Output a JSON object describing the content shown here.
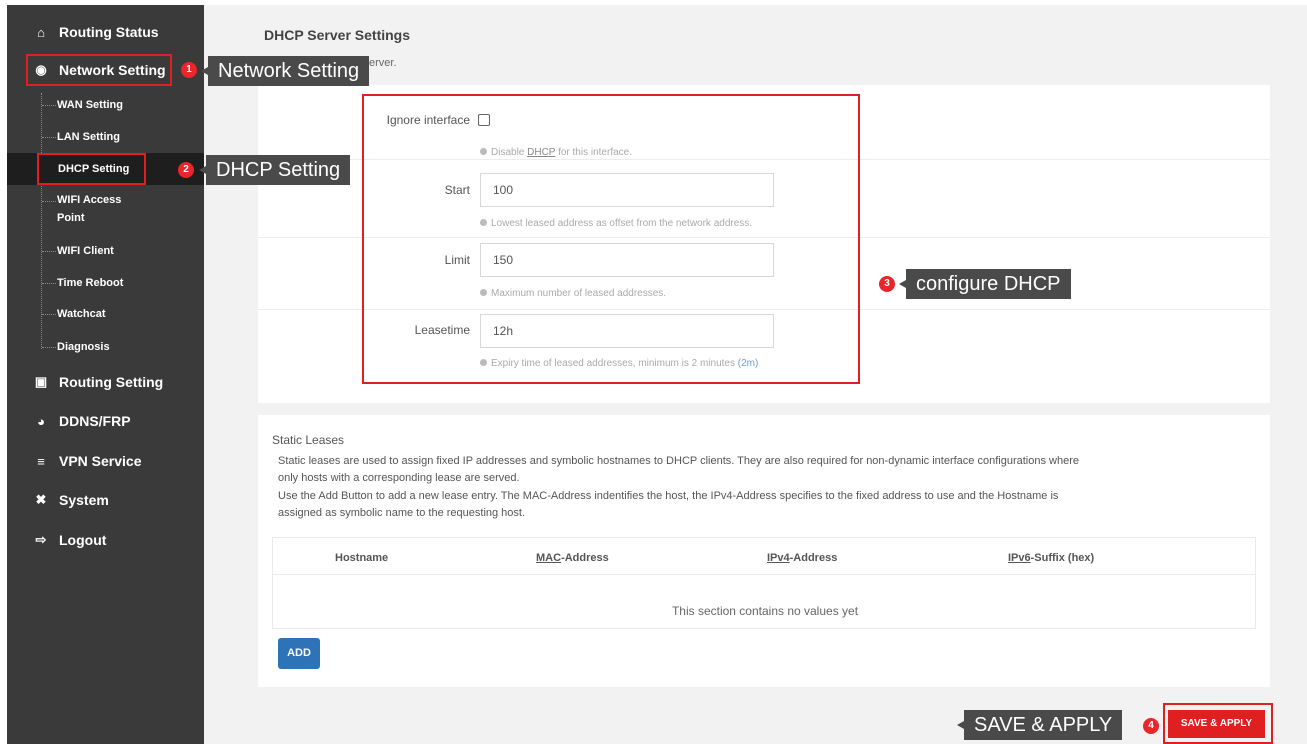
{
  "sidebar": {
    "main_items": [
      {
        "label": "Routing Status",
        "icon": "home-icon"
      },
      {
        "label": "Network Setting",
        "icon": "network-icon"
      },
      {
        "label": "Routing Setting",
        "icon": "calendar-icon"
      },
      {
        "label": "DDNS/FRP",
        "icon": "gauge-icon"
      },
      {
        "label": "VPN Service",
        "icon": "list-icon"
      },
      {
        "label": "System",
        "icon": "tools-icon"
      },
      {
        "label": "Logout",
        "icon": "logout-icon"
      }
    ],
    "sub_items": [
      {
        "label": "WAN Setting"
      },
      {
        "label": "LAN Setting"
      },
      {
        "label": "DHCP Setting"
      },
      {
        "label": "WIFI Access Point"
      },
      {
        "label": "WIFI Client"
      },
      {
        "label": "Time Reboot"
      },
      {
        "label": "Watchcat"
      },
      {
        "label": "Diagnosis"
      }
    ]
  },
  "callouts": {
    "network": {
      "number": "1",
      "text": "Network Setting"
    },
    "dhcp": {
      "number": "2",
      "text": "DHCP Setting"
    },
    "configure": {
      "number": "3",
      "text": "configure DHCP"
    },
    "save": {
      "number": "4",
      "text": "SAVE & APPLY"
    }
  },
  "dhcp_server": {
    "title": "DHCP Server Settings",
    "description_partial": "erver.",
    "ignore_interface": {
      "label": "Ignore interface",
      "checked": false,
      "hint_prefix": "Disable ",
      "hint_link": "DHCP",
      "hint_suffix": " for this interface."
    },
    "start": {
      "label": "Start",
      "value": "100",
      "hint": "Lowest leased address as offset from the network address."
    },
    "limit": {
      "label": "Limit",
      "value": "150",
      "hint": "Maximum number of leased addresses."
    },
    "leasetime": {
      "label": "Leasetime",
      "value": "12h",
      "hint": "Expiry time of leased addresses, minimum is 2 minutes ",
      "hint_tag": "(2m)"
    }
  },
  "static_leases": {
    "title": "Static Leases",
    "line1": "Static leases are used to assign fixed IP addresses and symbolic hostnames to DHCP clients. They are also required for non-dynamic interface configurations where",
    "line2": "only hosts with a corresponding lease are served.",
    "line3": "Use the Add Button to add a new lease entry. The MAC-Address indentifies the host, the IPv4-Address specifies to the fixed address to use and the Hostname is",
    "line4": "assigned as symbolic name to the requesting host.",
    "columns": {
      "hostname": "Hostname",
      "mac_u": "MAC",
      "mac_rest": "-Address",
      "ipv4_u": "IPv4",
      "ipv4_rest": "-Address",
      "ipv6_u": "IPv6",
      "ipv6_rest": "-Suffix (hex)"
    },
    "empty_message": "This section contains no values yet",
    "add_label": "ADD"
  },
  "save_apply_label": "SAVE & APPLY",
  "colors": {
    "accent_red": "#e02020",
    "sidebar_bg": "#3a3a3a",
    "button_blue": "#2e73b8"
  }
}
